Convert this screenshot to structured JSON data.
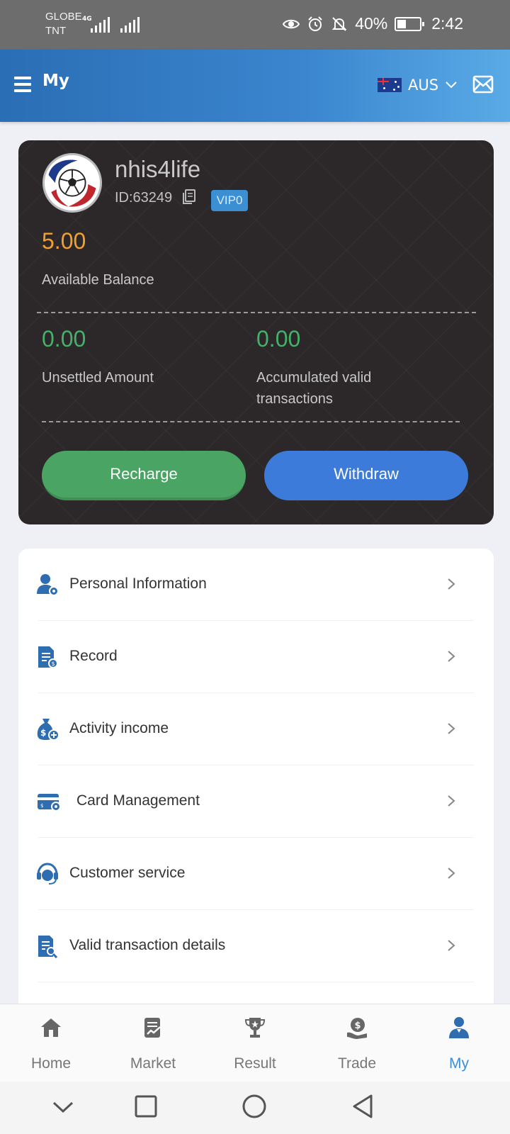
{
  "status_bar": {
    "carrier_1": "GLOBE",
    "carrier_2": "TNT",
    "network": "4G",
    "battery": "40%",
    "time": "2:42"
  },
  "app_bar": {
    "title": "My",
    "region": "AUS",
    "icons": [
      "menu-icon",
      "australia-flag-icon",
      "chevron-down-icon",
      "mail-icon"
    ]
  },
  "profile": {
    "username": "nhis4life",
    "id": "ID:63249",
    "vip": "VIP0"
  },
  "balance": {
    "value": "5.00",
    "label": "Available Balance"
  },
  "stats": [
    {
      "value": "0.00",
      "label": "Unsettled Amount"
    },
    {
      "value": "0.00",
      "label": "Accumulated valid transactions"
    }
  ],
  "actions": {
    "recharge": "Recharge",
    "withdraw": "Withdraw"
  },
  "menu": [
    {
      "label": "Personal Information",
      "icon": "user-settings-icon"
    },
    {
      "label": "Record",
      "icon": "document-dollar-icon"
    },
    {
      "label": "Activity income",
      "icon": "money-bag-icon"
    },
    {
      "label": "Card Management",
      "icon": "card-settings-icon"
    },
    {
      "label": "Customer service",
      "icon": "headset-icon"
    },
    {
      "label": "Valid transaction details",
      "icon": "document-search-icon"
    }
  ],
  "bottom_nav": [
    {
      "label": "Home",
      "icon": "home-icon",
      "active": false
    },
    {
      "label": "Market",
      "icon": "market-chart-icon",
      "active": false
    },
    {
      "label": "Result",
      "icon": "trophy-icon",
      "active": false
    },
    {
      "label": "Trade",
      "icon": "trade-dollar-icon",
      "active": false
    },
    {
      "label": "My",
      "icon": "user-icon",
      "active": true
    }
  ],
  "colors": {
    "accent": "#3a8fd9",
    "balance": "#f0a030",
    "stat": "#45b06a",
    "recharge": "#4aa464",
    "withdraw": "#3d7bdb",
    "card_bg": "#2c2829",
    "icon": "#2d6db0"
  }
}
